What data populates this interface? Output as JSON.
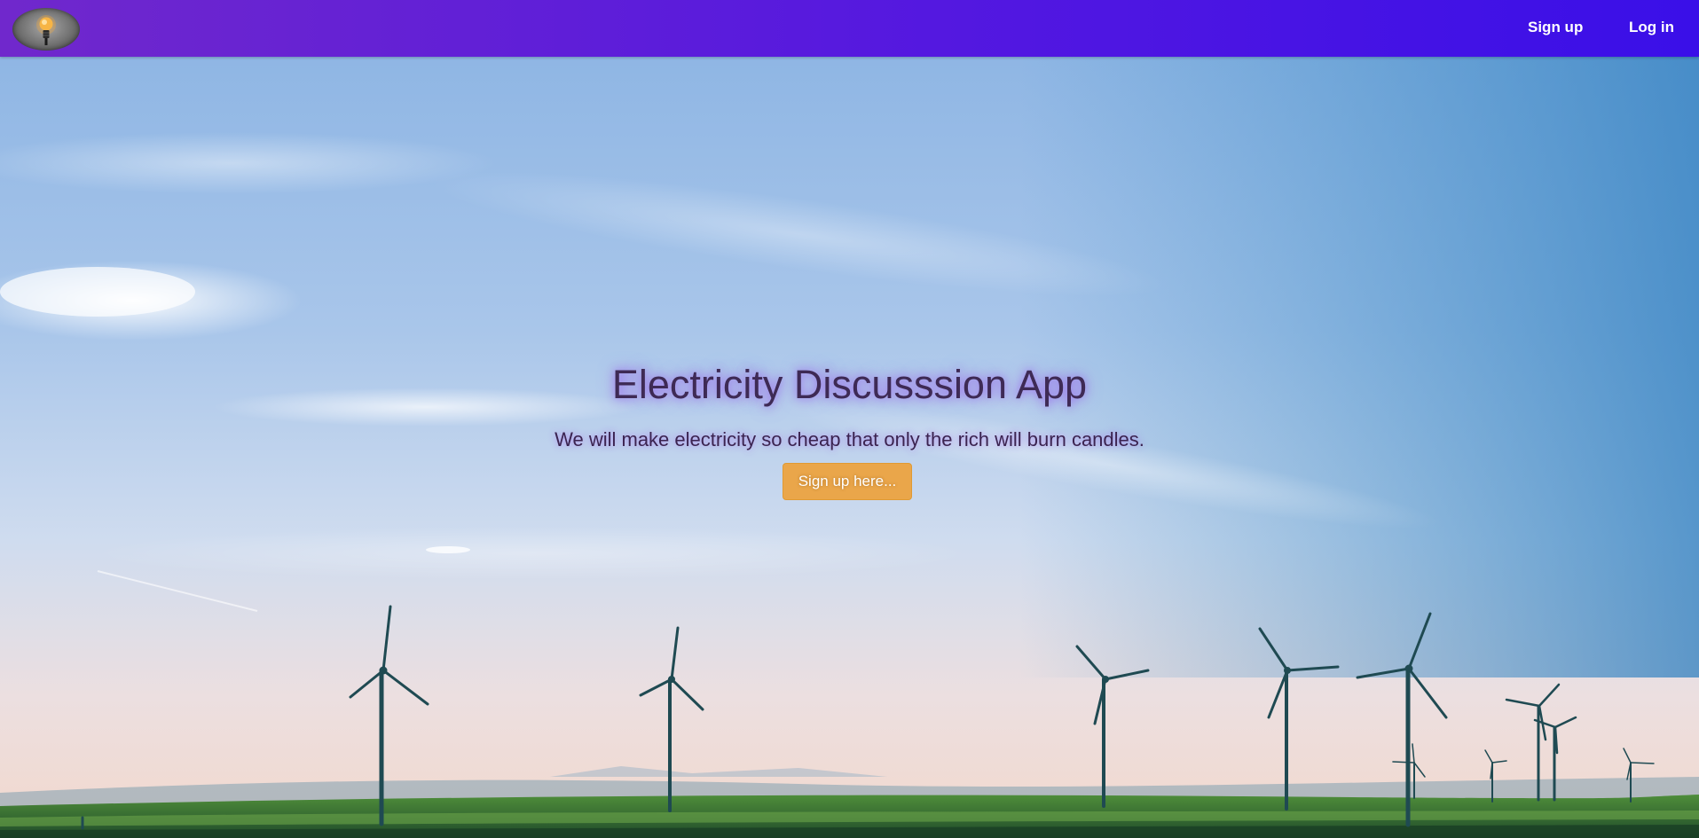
{
  "nav": {
    "signup_label": "Sign up",
    "login_label": "Log in"
  },
  "hero": {
    "title": "Electricity Discusssion App",
    "tagline": "We will make electricity so cheap that only the rich will burn candles.",
    "cta_label": "Sign up here..."
  },
  "icons": {
    "logo": "lightbulb-icon"
  },
  "colors": {
    "nav_gradient_start": "#7028cc",
    "nav_gradient_end": "#3a0fe8",
    "cta_background": "#eaa64a",
    "title_text": "#3e2a55"
  }
}
